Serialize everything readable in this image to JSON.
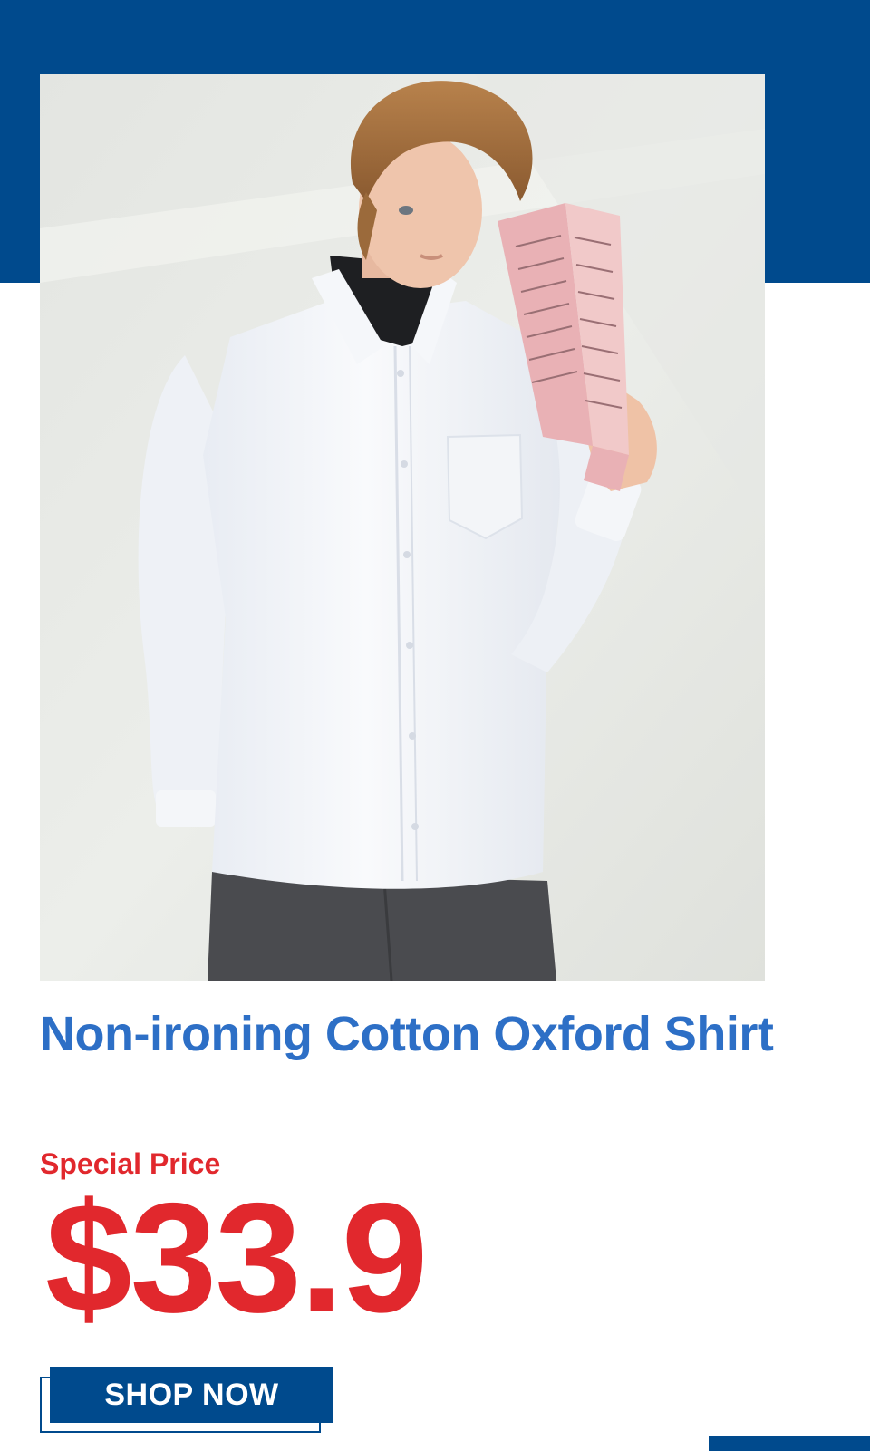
{
  "colors": {
    "brand_blue": "#004a8d",
    "title_blue": "#2d6fc6",
    "price_red": "#e1282d",
    "background": "#ffffff"
  },
  "product": {
    "title": "Non-ironing Cotton Oxford Shirt",
    "photo_icon": "model-wearing-white-oxford-shirt-image"
  },
  "promo": {
    "label": "Special Price",
    "price": "$33.9"
  },
  "cta": {
    "label": "SHOP NOW"
  }
}
